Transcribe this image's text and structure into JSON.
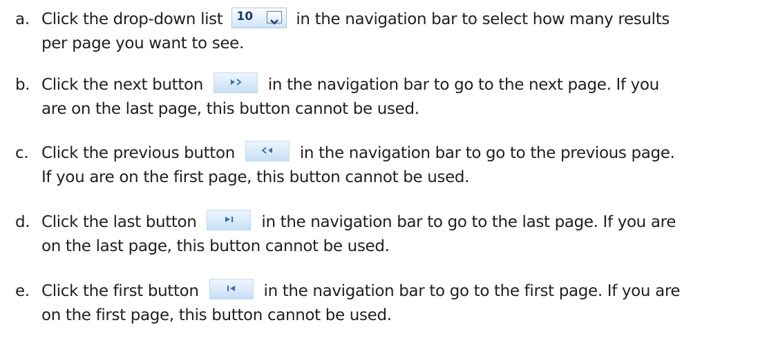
{
  "instructions": [
    {
      "marker": "a.",
      "line1_before": "Click the drop-down list",
      "line1_after": "in the navigation bar to select how many results",
      "line2": "per page you want to see.",
      "control": {
        "kind": "dropdown",
        "value": "10"
      }
    },
    {
      "marker": "b.",
      "line1_before": "Click the next button",
      "line1_after": "in the navigation bar to go to the next page. If you",
      "line2": "are on the last page, this button cannot be used.",
      "control": {
        "kind": "button",
        "icon": "next-icon"
      }
    },
    {
      "marker": "c.",
      "line1_before": "Click the previous button",
      "line1_after": "in the navigation bar to go to the previous page.",
      "line2": "If you are on the first page, this button cannot be used.",
      "control": {
        "kind": "button",
        "icon": "previous-icon"
      }
    },
    {
      "marker": "d.",
      "line1_before": "Click the last button",
      "line1_after": "in the navigation bar to go to the last page. If you are",
      "line2": "on the last page, this button cannot be used.",
      "control": {
        "kind": "button",
        "icon": "last-page-icon"
      }
    },
    {
      "marker": "e.",
      "line1_before": "Click the first button",
      "line1_after": "in the navigation bar to go to the first page. If you are",
      "line2": "on the first page, this button cannot be used.",
      "control": {
        "kind": "button",
        "icon": "first-page-icon"
      }
    }
  ],
  "colors": {
    "text": "#1f1f1f",
    "button_gradient_top": "#eef6fd",
    "button_gradient_bottom": "#c6def6",
    "icon_blue": "#3a6fb0",
    "dropdown_text": "#1b3b6f"
  }
}
